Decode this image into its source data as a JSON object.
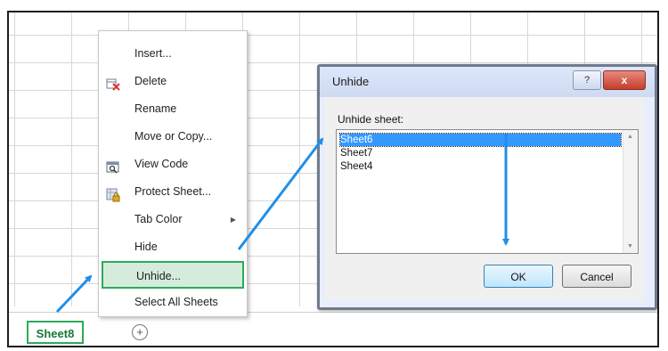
{
  "context_menu": {
    "items": [
      {
        "label": "Insert...",
        "icon": ""
      },
      {
        "label": "Delete",
        "icon": "delete-sheet-icon"
      },
      {
        "label": "Rename",
        "icon": ""
      },
      {
        "label": "Move or Copy...",
        "icon": ""
      },
      {
        "label": "View Code",
        "icon": "view-code-icon"
      },
      {
        "label": "Protect Sheet...",
        "icon": "protect-sheet-icon"
      },
      {
        "label": "Tab Color",
        "icon": "",
        "submenu_icon": "chevron-right-icon",
        "submenu_glyph": "▶"
      },
      {
        "label": "Hide",
        "icon": ""
      },
      {
        "label": "Unhide...",
        "icon": "",
        "selected": true
      },
      {
        "label": "Select All Sheets",
        "icon": ""
      }
    ]
  },
  "dialog": {
    "title": "Unhide",
    "help_label": "?",
    "close_label": "x",
    "list_label": "Unhide sheet:",
    "sheets": [
      "Sheet6",
      "Sheet7",
      "Sheet4"
    ],
    "selected_sheet": "Sheet6",
    "ok_label": "OK",
    "cancel_label": "Cancel"
  },
  "tab_bar": {
    "active_sheet": "Sheet8",
    "add_sheet_label": "+"
  },
  "colors": {
    "highlight_green": "#2bab5a",
    "arrow_blue": "#1f8fe8",
    "selection_blue": "#3399ff"
  }
}
